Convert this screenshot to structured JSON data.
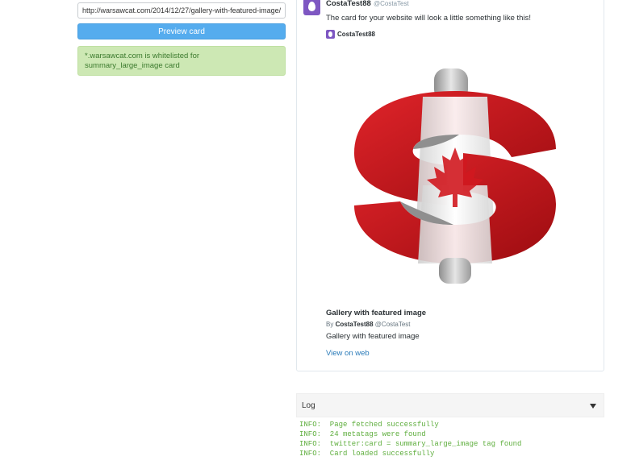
{
  "form": {
    "url_value": "http://warsawcat.com/2014/12/27/gallery-with-featured-image/",
    "preview_button_label": "Preview card",
    "success_message": "*.warsawcat.com is whitelisted for summary_large_image card"
  },
  "tweet": {
    "author_name": "CostaTest88",
    "author_handle": "@CostaTest",
    "text": "The card for your website will look a little something like this!",
    "card_author_name": "CostaTest88",
    "avatar_color": "#7e57c2"
  },
  "card": {
    "image_icon": "canadian-flag-dollar-sign-image",
    "title": "Gallery with featured image",
    "byline_prefix": "By",
    "byline_name": "CostaTest88",
    "byline_handle": "@CostaTest",
    "description": "Gallery with featured image",
    "view_link": "View on web"
  },
  "log": {
    "title": "Log",
    "lines": [
      "INFO:  Page fetched successfully",
      "INFO:  24 metatags were found",
      "INFO:  twitter:card = summary_large_image tag found",
      "INFO:  Card loaded successfully"
    ]
  },
  "colors": {
    "accent_button": "#55acee",
    "success_bg": "#cde8b4",
    "log_text": "#5fae3e",
    "link": "#2b7bb9"
  }
}
